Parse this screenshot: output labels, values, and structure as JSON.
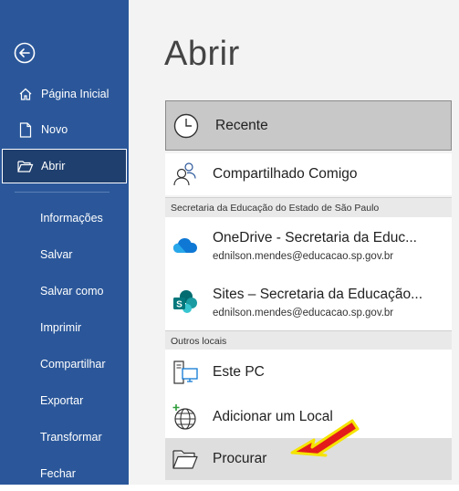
{
  "sidebar": {
    "items": [
      {
        "label": "Página Inicial"
      },
      {
        "label": "Novo"
      },
      {
        "label": "Abrir"
      },
      {
        "label": "Informações"
      },
      {
        "label": "Salvar"
      },
      {
        "label": "Salvar como"
      },
      {
        "label": "Imprimir"
      },
      {
        "label": "Compartilhar"
      },
      {
        "label": "Exportar"
      },
      {
        "label": "Transformar"
      },
      {
        "label": "Fechar"
      }
    ],
    "active": "Abrir"
  },
  "main": {
    "title": "Abrir",
    "recent_label": "Recente",
    "shared_label": "Compartilhado Comigo",
    "section_org": "Secretaria da Educação do Estado de São Paulo",
    "onedrive": {
      "title": "OneDrive - Secretaria da Educ...",
      "account": "ednilson.mendes@educacao.sp.gov.br"
    },
    "sites": {
      "title": "Sites – Secretaria da Educação...",
      "account": "ednilson.mendes@educacao.sp.gov.br"
    },
    "section_other": "Outros locais",
    "this_pc_label": "Este PC",
    "add_place_label": "Adicionar um Local",
    "browse_label": "Procurar"
  },
  "colors": {
    "sidebar": "#2b579a",
    "active_item": "#1f3f6e",
    "annotation_arrow": "#e31b1b",
    "annotation_outline": "#f5e400"
  }
}
